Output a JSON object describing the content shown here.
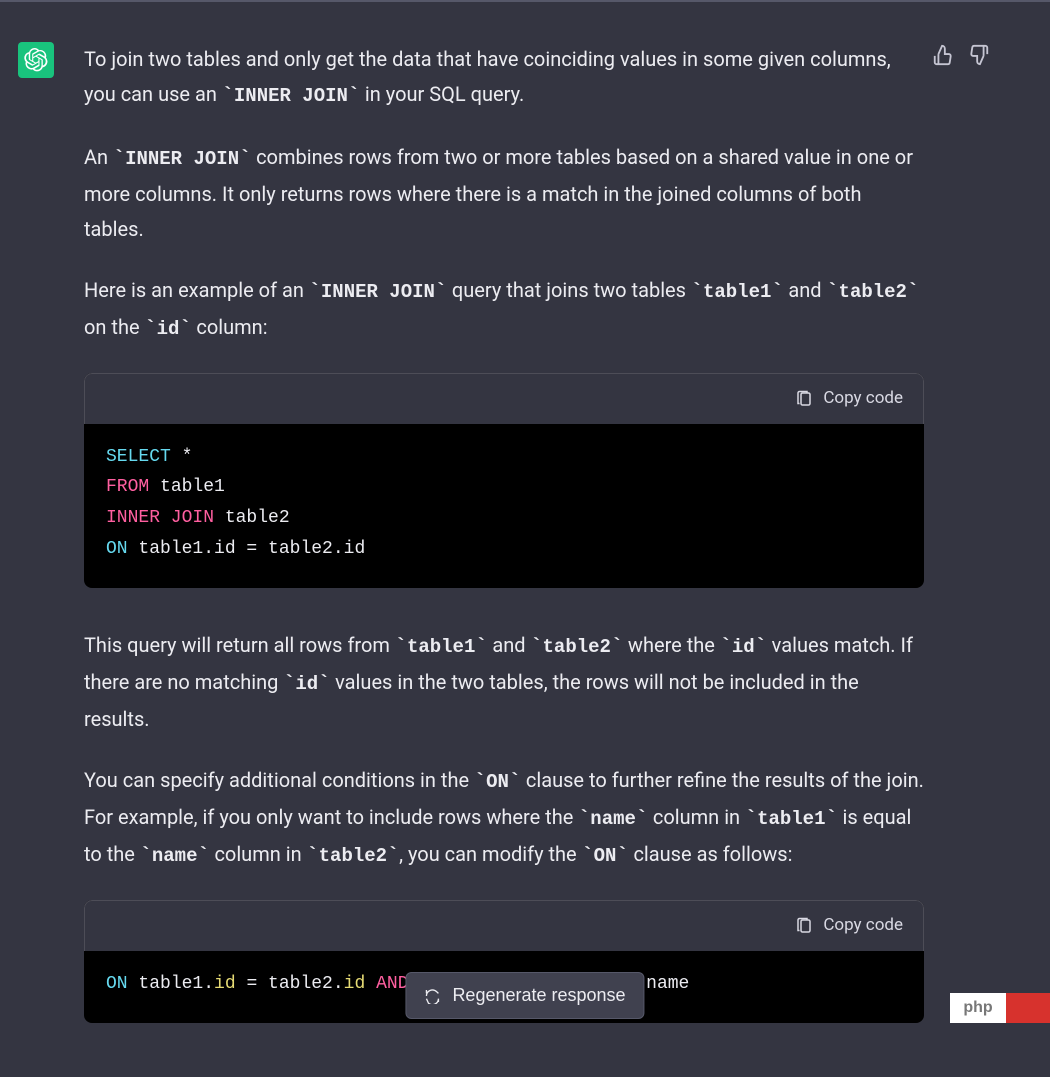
{
  "paragraphs": {
    "p1a": "To join two tables and only get the data that have coinciding values in some given columns, you can use an ",
    "p1_code": "INNER JOIN",
    "p1b": " in your SQL query.",
    "p2a": "An ",
    "p2_code": "INNER JOIN",
    "p2b": " combines rows from two or more tables based on a shared value in one or more columns. It only returns rows where there is a match in the joined columns of both tables.",
    "p3a": "Here is an example of an ",
    "p3_code1": "INNER JOIN",
    "p3b": " query that joins two tables ",
    "p3_code2": "table1",
    "p3c": " and ",
    "p3_code3": "table2",
    "p3d": " on the ",
    "p3_code4": "id",
    "p3e": " column:",
    "p4a": "This query will return all rows from ",
    "p4_code1": "table1",
    "p4b": " and ",
    "p4_code2": "table2",
    "p4c": " where the ",
    "p4_code3": "id",
    "p4d": " values match. If there are no matching ",
    "p4_code4": "id",
    "p4e": " values in the two tables, the rows will not be included in the results.",
    "p5a": "You can specify additional conditions in the ",
    "p5_code1": "ON",
    "p5b": " clause to further refine the results of the join. For example, if you only want to include rows where the ",
    "p5_code2": "name",
    "p5c": " column in ",
    "p5_code3": "table1",
    "p5d": " is equal to the ",
    "p5_code4": "name",
    "p5e": " column in ",
    "p5_code5": "table2",
    "p5f": ", you can modify the ",
    "p5_code6": "ON",
    "p5g": " clause as follows:"
  },
  "code1": {
    "copy_label": "Copy code",
    "select": "SELECT",
    "star": " *",
    "from": "FROM",
    "t1": " table1",
    "ij": "INNER JOIN",
    "t2": " table2",
    "on": "ON",
    "rest": " table1.id = table2.id"
  },
  "code2": {
    "copy_label": "Copy code",
    "on": "ON",
    "a": " table1.",
    "id1": "id",
    "b": " = table2.",
    "id2": "id",
    "sp": " ",
    "and": "AND",
    "c": " table1.name = table2.name"
  },
  "regenerate_label": "Regenerate response",
  "badge": {
    "text": "php"
  }
}
